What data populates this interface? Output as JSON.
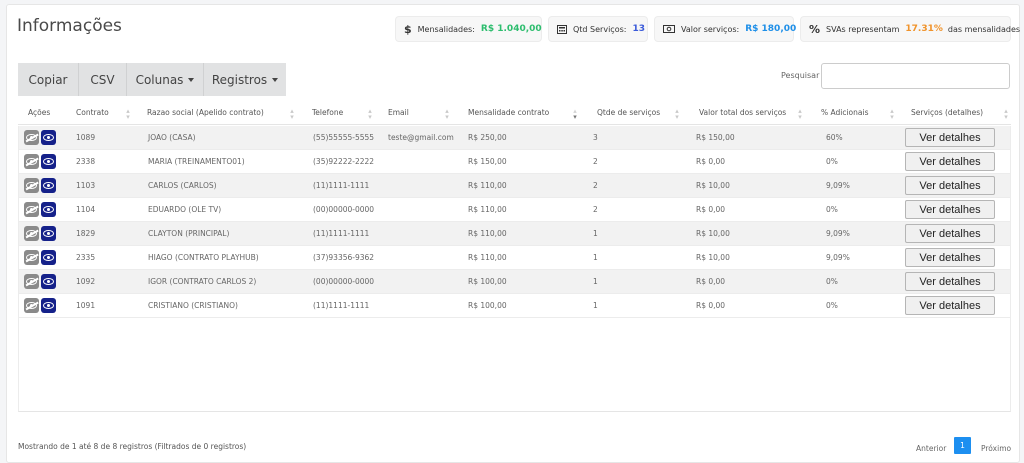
{
  "header": {
    "title": "Informações",
    "stats": [
      {
        "icon": "dollar-icon",
        "label": "Mensalidades:",
        "value": "R$ 1.040,00",
        "value_color": "#2dbd6e"
      },
      {
        "icon": "calculator-icon",
        "label": "Qtd Serviços:",
        "value": "13",
        "value_color": "#3b5bd9"
      },
      {
        "icon": "money-bill-icon",
        "label": "Valor serviços:",
        "value": "R$ 180,00",
        "value_color": "#1e8fe8"
      },
      {
        "icon": "percent-icon",
        "label": "SVAs representam",
        "value": "17.31%",
        "value_color": "#f0932b",
        "suffix": "das mensalidades"
      }
    ]
  },
  "toolbar": {
    "copy_label": "Copiar",
    "csv_label": "CSV",
    "columns_label": "Colunas",
    "records_label": "Registros"
  },
  "search": {
    "label": "Pesquisar",
    "value": "",
    "placeholder": ""
  },
  "table": {
    "columns": [
      "Ações",
      "Contrato",
      "Razao social (Apelido contrato)",
      "Telefone",
      "Email",
      "Mensalidade contrato",
      "Qtde de serviços",
      "Valor total dos serviços",
      "% Adicionais",
      "Serviços (detalhes)"
    ],
    "detail_button_label": "Ver detalhes",
    "rows": [
      {
        "contrato": "1089",
        "razao": "JOAO (CASA)",
        "telefone": "(55)55555-5555",
        "email": "teste@gmail.com",
        "mensalidade": "R$ 250,00",
        "qtde": "3",
        "valor": "R$ 150,00",
        "adicionais": "60%"
      },
      {
        "contrato": "2338",
        "razao": "MARIA (TREINAMENTO01)",
        "telefone": "(35)92222-2222",
        "email": "",
        "mensalidade": "R$ 150,00",
        "qtde": "2",
        "valor": "R$ 0,00",
        "adicionais": "0%"
      },
      {
        "contrato": "1103",
        "razao": "CARLOS (CARLOS)",
        "telefone": "(11)1111-1111",
        "email": "",
        "mensalidade": "R$ 110,00",
        "qtde": "2",
        "valor": "R$ 10,00",
        "adicionais": "9,09%"
      },
      {
        "contrato": "1104",
        "razao": "EDUARDO (OLE TV)",
        "telefone": "(00)00000-0000",
        "email": "",
        "mensalidade": "R$ 110,00",
        "qtde": "2",
        "valor": "R$ 0,00",
        "adicionais": "0%"
      },
      {
        "contrato": "1829",
        "razao": "CLAYTON (PRINCIPAL)",
        "telefone": "(11)1111-1111",
        "email": "",
        "mensalidade": "R$ 110,00",
        "qtde": "1",
        "valor": "R$ 10,00",
        "adicionais": "9,09%"
      },
      {
        "contrato": "2335",
        "razao": "HIAGO (CONTRATO PLAYHUB)",
        "telefone": "(37)93356-9362",
        "email": "",
        "mensalidade": "R$ 110,00",
        "qtde": "1",
        "valor": "R$ 10,00",
        "adicionais": "9,09%"
      },
      {
        "contrato": "1092",
        "razao": "IGOR (CONTRATO CARLOS 2)",
        "telefone": "(00)00000-0000",
        "email": "",
        "mensalidade": "R$ 100,00",
        "qtde": "1",
        "valor": "R$ 0,00",
        "adicionais": "0%"
      },
      {
        "contrato": "1091",
        "razao": "CRISTIANO (CRISTIANO)",
        "telefone": "(11)1111-1111",
        "email": "",
        "mensalidade": "R$ 100,00",
        "qtde": "1",
        "valor": "R$ 0,00",
        "adicionais": "0%"
      }
    ]
  },
  "footer": {
    "info": "Mostrando de 1 até 8 de 8 registros (Filtrados de 0 registros)",
    "prev_label": "Anterior",
    "current_page": "1",
    "next_label": "Próximo"
  }
}
